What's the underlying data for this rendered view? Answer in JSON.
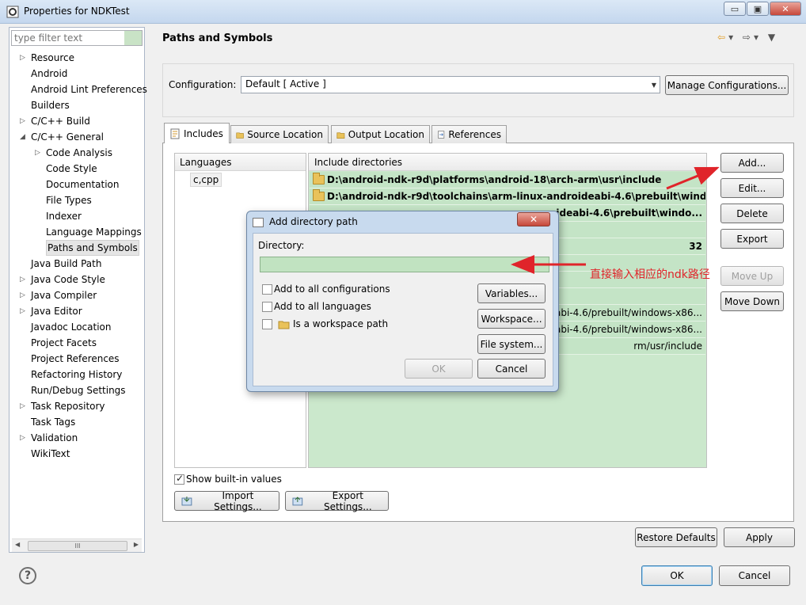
{
  "window": {
    "title": "Properties for NDKTest",
    "controls": [
      "minimize",
      "maximize",
      "close"
    ],
    "control_glyphs": {
      "minimize": "▭",
      "maximize": "▣",
      "close": "✕"
    }
  },
  "sidebar": {
    "filter_placeholder": "type filter text",
    "items": [
      {
        "label": "Resource",
        "expandable": true,
        "indent": 0
      },
      {
        "label": "Android",
        "expandable": false,
        "indent": 0
      },
      {
        "label": "Android Lint Preferences",
        "expandable": false,
        "indent": 0
      },
      {
        "label": "Builders",
        "expandable": false,
        "indent": 0
      },
      {
        "label": "C/C++ Build",
        "expandable": true,
        "indent": 0
      },
      {
        "label": "C/C++ General",
        "expandable": true,
        "expanded": true,
        "indent": 0
      },
      {
        "label": "Code Analysis",
        "expandable": true,
        "indent": 1
      },
      {
        "label": "Code Style",
        "expandable": false,
        "indent": 1
      },
      {
        "label": "Documentation",
        "expandable": false,
        "indent": 1
      },
      {
        "label": "File Types",
        "expandable": false,
        "indent": 1
      },
      {
        "label": "Indexer",
        "expandable": false,
        "indent": 1
      },
      {
        "label": "Language Mappings",
        "expandable": false,
        "indent": 1
      },
      {
        "label": "Paths and Symbols",
        "expandable": false,
        "indent": 1,
        "selected": true
      },
      {
        "label": "Java Build Path",
        "expandable": false,
        "indent": 0
      },
      {
        "label": "Java Code Style",
        "expandable": true,
        "indent": 0
      },
      {
        "label": "Java Compiler",
        "expandable": true,
        "indent": 0
      },
      {
        "label": "Java Editor",
        "expandable": true,
        "indent": 0
      },
      {
        "label": "Javadoc Location",
        "expandable": false,
        "indent": 0
      },
      {
        "label": "Project Facets",
        "expandable": false,
        "indent": 0
      },
      {
        "label": "Project References",
        "expandable": false,
        "indent": 0
      },
      {
        "label": "Refactoring History",
        "expandable": false,
        "indent": 0
      },
      {
        "label": "Run/Debug Settings",
        "expandable": false,
        "indent": 0
      },
      {
        "label": "Task Repository",
        "expandable": true,
        "indent": 0
      },
      {
        "label": "Task Tags",
        "expandable": false,
        "indent": 0
      },
      {
        "label": "Validation",
        "expandable": true,
        "indent": 0
      },
      {
        "label": "WikiText",
        "expandable": false,
        "indent": 0
      }
    ],
    "scroll_grip": "III"
  },
  "page": {
    "title": "Paths and Symbols",
    "configuration_label": "Configuration:",
    "configuration_value": "Default  [ Active ]",
    "manage_button": "Manage Configurations..."
  },
  "tabs": [
    {
      "label": "Includes",
      "active": true
    },
    {
      "label": "Source Location",
      "active": false
    },
    {
      "label": "Output Location",
      "active": false
    },
    {
      "label": "References",
      "active": false
    }
  ],
  "languages": {
    "header": "Languages",
    "items": [
      "c,cpp"
    ]
  },
  "include_dirs": {
    "header": "Include directories",
    "rows": [
      {
        "text": "D:\\android-ndk-r9d\\platforms\\android-18\\arch-arm\\usr\\include",
        "bold": true
      },
      {
        "text": "D:\\android-ndk-r9d\\toolchains\\arm-linux-androideabi-4.6\\prebuilt\\windo...",
        "bold": true
      },
      {
        "text": "ideabi-4.6\\prebuilt\\windo...",
        "bold": true,
        "partial": true
      },
      {
        "text": "",
        "bold": false
      },
      {
        "text": "32",
        "bold": true,
        "partial": true
      },
      {
        "text": "",
        "bold": false
      },
      {
        "text": "",
        "bold": false
      },
      {
        "text": "",
        "bold": false
      },
      {
        "text": "eabi-4.6/prebuilt/windows-x86...",
        "bold": false,
        "partial": true
      },
      {
        "text": "eabi-4.6/prebuilt/windows-x86...",
        "bold": false,
        "partial": true
      },
      {
        "text": "rm/usr/include",
        "bold": false,
        "partial": true
      }
    ]
  },
  "side_buttons": {
    "add": "Add...",
    "edit": "Edit...",
    "delete": "Delete",
    "export": "Export",
    "move_up": "Move Up",
    "move_down": "Move Down"
  },
  "show_builtin": {
    "label": "Show built-in values",
    "checked": true
  },
  "import_settings": "Import Settings...",
  "export_settings": "Export Settings...",
  "restore_defaults": "Restore Defaults",
  "apply": "Apply",
  "ok": "OK",
  "cancel": "Cancel",
  "help_glyph": "?",
  "dialog": {
    "title": "Add directory path",
    "close_glyph": "✕",
    "directory_label": "Directory:",
    "directory_value": "",
    "add_all_configs": {
      "label": "Add to all configurations",
      "checked": false
    },
    "add_all_langs": {
      "label": "Add to all languages",
      "checked": false
    },
    "workspace_path": {
      "label": "Is a workspace path",
      "checked": false
    },
    "variables": "Variables...",
    "workspace": "Workspace...",
    "file_system": "File system...",
    "ok": "OK",
    "cancel": "Cancel"
  },
  "annotation": {
    "text": "直接输入相应的ndk路径",
    "color": "#e0242a"
  }
}
